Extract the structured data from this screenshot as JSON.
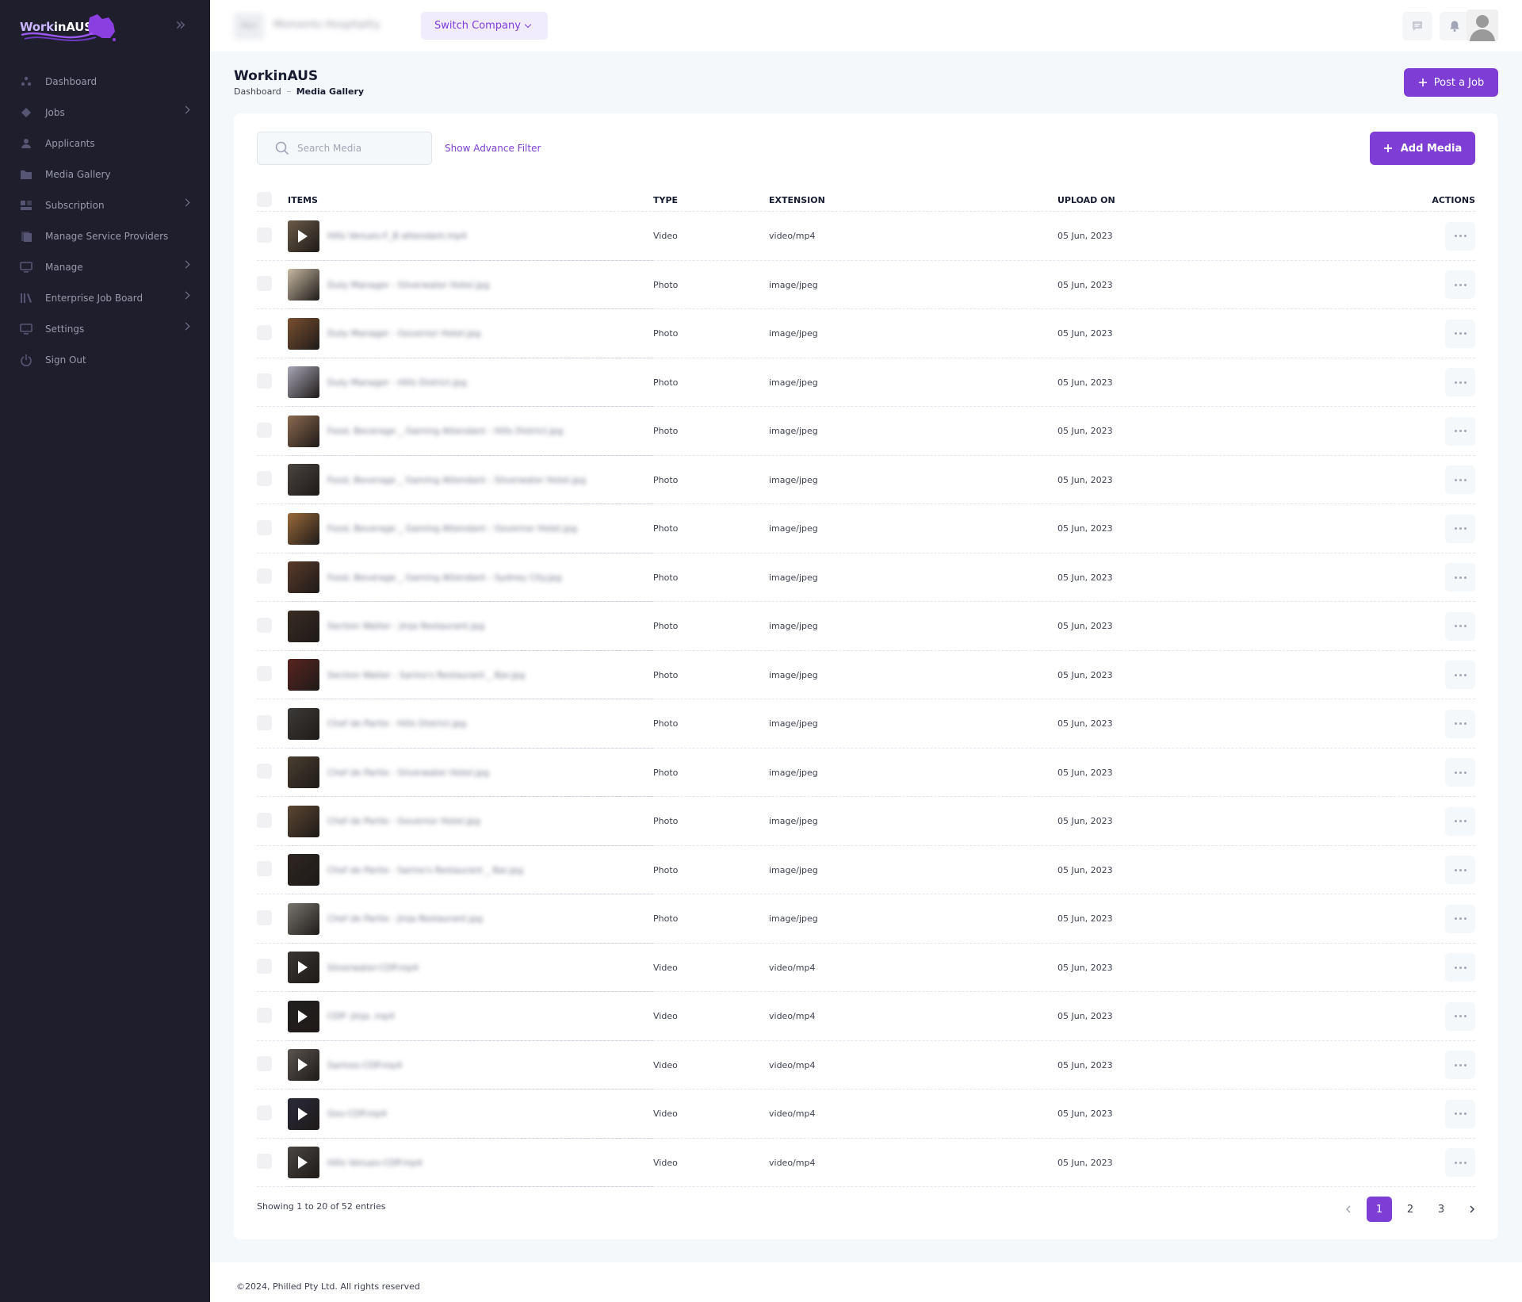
{
  "app": {
    "logo_text_a": "Work",
    "logo_text_b": "inAUS"
  },
  "sidebar": {
    "items": [
      {
        "label": "Dashboard",
        "icon": "dashboard-icon",
        "arrow": false
      },
      {
        "label": "Jobs",
        "icon": "jobs-icon",
        "arrow": true
      },
      {
        "label": "Applicants",
        "icon": "user-icon",
        "arrow": false
      },
      {
        "label": "Media Gallery",
        "icon": "folder-icon",
        "arrow": false
      },
      {
        "label": "Subscription",
        "icon": "subscription-icon",
        "arrow": true
      },
      {
        "label": "Manage Service Providers",
        "icon": "providers-icon",
        "arrow": false
      },
      {
        "label": "Manage",
        "icon": "monitor-icon",
        "arrow": true
      },
      {
        "label": "Enterprise Job Board",
        "icon": "library-icon",
        "arrow": true
      },
      {
        "label": "Settings",
        "icon": "monitor-icon",
        "arrow": true
      },
      {
        "label": "Sign Out",
        "icon": "power-icon",
        "arrow": false
      }
    ]
  },
  "topbar": {
    "company_logo": "Rom",
    "company_name": "Momento Hospitality",
    "switch_company": "Switch Company"
  },
  "page": {
    "title": "WorkinAUS",
    "breadcrumb_home": "Dashboard",
    "breadcrumb_current": "Media Gallery",
    "post_job": "Post a Job"
  },
  "toolbar": {
    "search_placeholder": "Search Media",
    "advance_filter": "Show Advance Filter",
    "add_media": "Add Media"
  },
  "table": {
    "headers": {
      "items": "ITEMS",
      "type": "TYPE",
      "extension": "EXTENSION",
      "upload_on": "UPLOAD ON",
      "actions": "ACTIONS"
    },
    "rows": [
      {
        "name": "Hills Venues-F_B attendant.mp4",
        "type": "Video",
        "ext": "video/mp4",
        "date": "05 Jun, 2023",
        "thumb": "#6b5a48"
      },
      {
        "name": "Duty Manager - Silverwater Hotel.jpg",
        "type": "Photo",
        "ext": "image/jpeg",
        "date": "05 Jun, 2023",
        "thumb": "#c9b9a3"
      },
      {
        "name": "Duty Manager - Governor Hotel.jpg",
        "type": "Photo",
        "ext": "image/jpeg",
        "date": "05 Jun, 2023",
        "thumb": "#7a5030"
      },
      {
        "name": "Duty Manager - Hills District.jpg",
        "type": "Photo",
        "ext": "image/jpeg",
        "date": "05 Jun, 2023",
        "thumb": "#a9a6b8"
      },
      {
        "name": "Food, Beverage _ Gaming Attendant - Hills District.jpg",
        "type": "Photo",
        "ext": "image/jpeg",
        "date": "05 Jun, 2023",
        "thumb": "#8c6a4f"
      },
      {
        "name": "Food, Beverage _ Gaming Attendant - Silverwater Hotel.jpg",
        "type": "Photo",
        "ext": "image/jpeg",
        "date": "05 Jun, 2023",
        "thumb": "#4a4440"
      },
      {
        "name": "Food, Beverage _ Gaming Attendant - Governor Hotel.jpg",
        "type": "Photo",
        "ext": "image/jpeg",
        "date": "05 Jun, 2023",
        "thumb": "#9a6a3a"
      },
      {
        "name": "Food, Beverage _ Gaming Attendant - Sydney City.jpg",
        "type": "Photo",
        "ext": "image/jpeg",
        "date": "05 Jun, 2023",
        "thumb": "#5a3a2a"
      },
      {
        "name": "Section Waiter - Jinja Restaurant.jpg",
        "type": "Photo",
        "ext": "image/jpeg",
        "date": "05 Jun, 2023",
        "thumb": "#3a2c24"
      },
      {
        "name": "Section Waiter - Sarino's Restaurant _ Bar.jpg",
        "type": "Photo",
        "ext": "image/jpeg",
        "date": "05 Jun, 2023",
        "thumb": "#5a2420"
      },
      {
        "name": "Chef de Partie - Hills District.jpg",
        "type": "Photo",
        "ext": "image/jpeg",
        "date": "05 Jun, 2023",
        "thumb": "#3c3a38"
      },
      {
        "name": "Chef de Partie - Silverwater Hotel.jpg",
        "type": "Photo",
        "ext": "image/jpeg",
        "date": "05 Jun, 2023",
        "thumb": "#4a3e30"
      },
      {
        "name": "Chef de Partie - Governor Hotel.jpg",
        "type": "Photo",
        "ext": "image/jpeg",
        "date": "05 Jun, 2023",
        "thumb": "#5c4632"
      },
      {
        "name": "Chef de Partie - Sarino's Restaurant _ Bar.jpg",
        "type": "Photo",
        "ext": "image/jpeg",
        "date": "05 Jun, 2023",
        "thumb": "#2e2622"
      },
      {
        "name": "Chef de Partie - Jinja Restaurant.jpg",
        "type": "Photo",
        "ext": "image/jpeg",
        "date": "05 Jun, 2023",
        "thumb": "#7a7670"
      },
      {
        "name": "Silverwater-CDP.mp4",
        "type": "Video",
        "ext": "video/mp4",
        "date": "05 Jun, 2023",
        "thumb": "#3a3634"
      },
      {
        "name": "CDP- Jinja .mp4",
        "type": "Video",
        "ext": "video/mp4",
        "date": "05 Jun, 2023",
        "thumb": "#222020"
      },
      {
        "name": "Sarinos-CDP.mp4",
        "type": "Video",
        "ext": "video/mp4",
        "date": "05 Jun, 2023",
        "thumb": "#5a5450"
      },
      {
        "name": "Gov-CDP.mp4",
        "type": "Video",
        "ext": "video/mp4",
        "date": "05 Jun, 2023",
        "thumb": "#2a2a3a"
      },
      {
        "name": "Hills Venues-CDP.mp4",
        "type": "Video",
        "ext": "video/mp4",
        "date": "05 Jun, 2023",
        "thumb": "#4a4644"
      }
    ]
  },
  "pagination": {
    "showing": "Showing 1 to 20 of 52 entries",
    "pages": [
      "1",
      "2",
      "3"
    ],
    "active": "1"
  },
  "footer": {
    "text": "©2024, Philled Pty Ltd. All rights reserved"
  },
  "colors": {
    "accent": "#7e3ed6",
    "sidebar_bg": "#1e1e2d",
    "page_bg": "#f5f8fa"
  }
}
